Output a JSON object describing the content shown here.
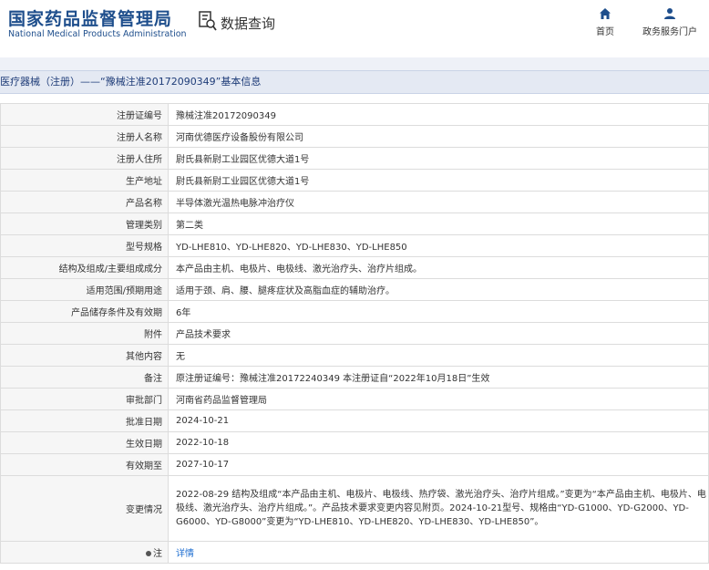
{
  "header": {
    "logo_title": "国家药品监督管理局",
    "logo_subtitle": "National Medical Products Administration",
    "query_label": "数据查询",
    "nav": {
      "home": "首页",
      "service": "政务服务门户"
    }
  },
  "page_title": "医疗器械（注册）——“豫械注准20172090349”基本信息",
  "rows": [
    {
      "key": "注册证编号",
      "value": "豫械注准20172090349"
    },
    {
      "key": "注册人名称",
      "value": "河南优德医疗设备股份有限公司"
    },
    {
      "key": "注册人住所",
      "value": "尉氏县新尉工业园区优德大道1号"
    },
    {
      "key": "生产地址",
      "value": "尉氏县新尉工业园区优德大道1号"
    },
    {
      "key": "产品名称",
      "value": "半导体激光温热电脉冲治疗仪"
    },
    {
      "key": "管理类别",
      "value": "第二类"
    },
    {
      "key": "型号规格",
      "value": "YD-LHE810、YD-LHE820、YD-LHE830、YD-LHE850"
    },
    {
      "key": "结构及组成/主要组成成分",
      "value": "本产品由主机、电极片、电极线、激光治疗头、治疗片组成。"
    },
    {
      "key": "适用范围/预期用途",
      "value": "适用于颈、肩、腰、腿疼症状及高脂血症的辅助治疗。"
    },
    {
      "key": "产品储存条件及有效期",
      "value": "6年"
    },
    {
      "key": "附件",
      "value": "产品技术要求"
    },
    {
      "key": "其他内容",
      "value": "无"
    },
    {
      "key": "备注",
      "value": "原注册证编号：豫械注准20172240349 本注册证自“2022年10月18日”生效"
    },
    {
      "key": "审批部门",
      "value": "河南省药品监督管理局"
    },
    {
      "key": "批准日期",
      "value": "2024-10-21"
    },
    {
      "key": "生效日期",
      "value": "2022-10-18"
    },
    {
      "key": "有效期至",
      "value": "2027-10-17"
    }
  ],
  "change": {
    "key": "变更情况",
    "value": "2022-08-29 结构及组成“本产品由主机、电极片、电极线、热疗袋、激光治疗头、治疗片组成。”变更为“本产品由主机、电极片、电极线、激光治疗头、治疗片组成。”。产品技术要求变更内容见附页。2024-10-21型号、规格由“YD-G1000、YD-G2000、YD-G6000、YD-G8000”变更为“YD-LHE810、YD-LHE820、YD-LHE830、YD-LHE850”。"
  },
  "note": {
    "key": "注",
    "link": "详情"
  }
}
